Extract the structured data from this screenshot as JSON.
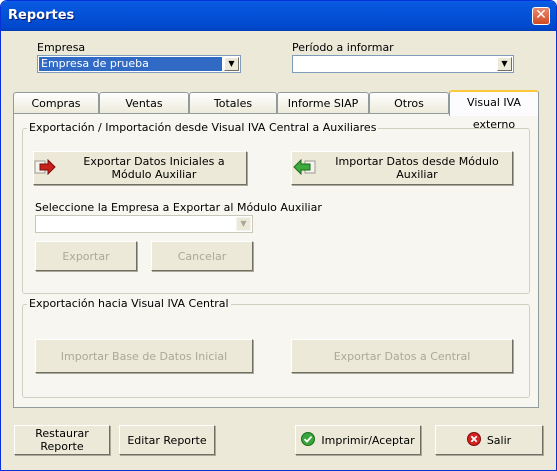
{
  "window": {
    "title": "Reportes",
    "close_glyph": "✕"
  },
  "empresa": {
    "label": "Empresa",
    "value": "Empresa de prueba"
  },
  "periodo": {
    "label": "Período a informar",
    "value": ""
  },
  "tabs": [
    {
      "label": "Compras"
    },
    {
      "label": "Ventas"
    },
    {
      "label": "Totales"
    },
    {
      "label": "Informe SIAP"
    },
    {
      "label": "Otros Listados"
    },
    {
      "label": "Visual IVA externo"
    }
  ],
  "active_tab": "Visual IVA externo",
  "group_import": {
    "title": "Exportación / Importación desde Visual IVA Central a Auxiliares",
    "export_initial": "Exportar Datos Iniciales a Módulo Auxiliar",
    "import_from_aux": "Importar Datos desde Módulo Auxiliar",
    "select_label": "Seleccione la Empresa a Exportar al Módulo Auxiliar",
    "select_value": "",
    "exportar": "Exportar",
    "cancelar": "Cancelar"
  },
  "group_export": {
    "title": "Exportación hacia Visual IVA Central",
    "import_base": "Importar Base de Datos Inicial",
    "export_central": "Exportar Datos a Central"
  },
  "footer": {
    "restaurar": "Restaurar Reporte",
    "editar": "Editar Reporte",
    "imprimir": "Imprimir/Aceptar",
    "salir": "Salir"
  },
  "colors": {
    "titlebar": "#0453d8",
    "selection": "#316ac5",
    "accept_icon": "#3aa53a",
    "exit_icon": "#d42020",
    "export_arrow": "#c8201a",
    "import_arrow": "#3caa3c"
  },
  "icons": {
    "export": "red-arrow-right-icon",
    "import": "green-arrow-left-icon",
    "accept": "green-check-icon",
    "exit": "red-x-icon"
  }
}
